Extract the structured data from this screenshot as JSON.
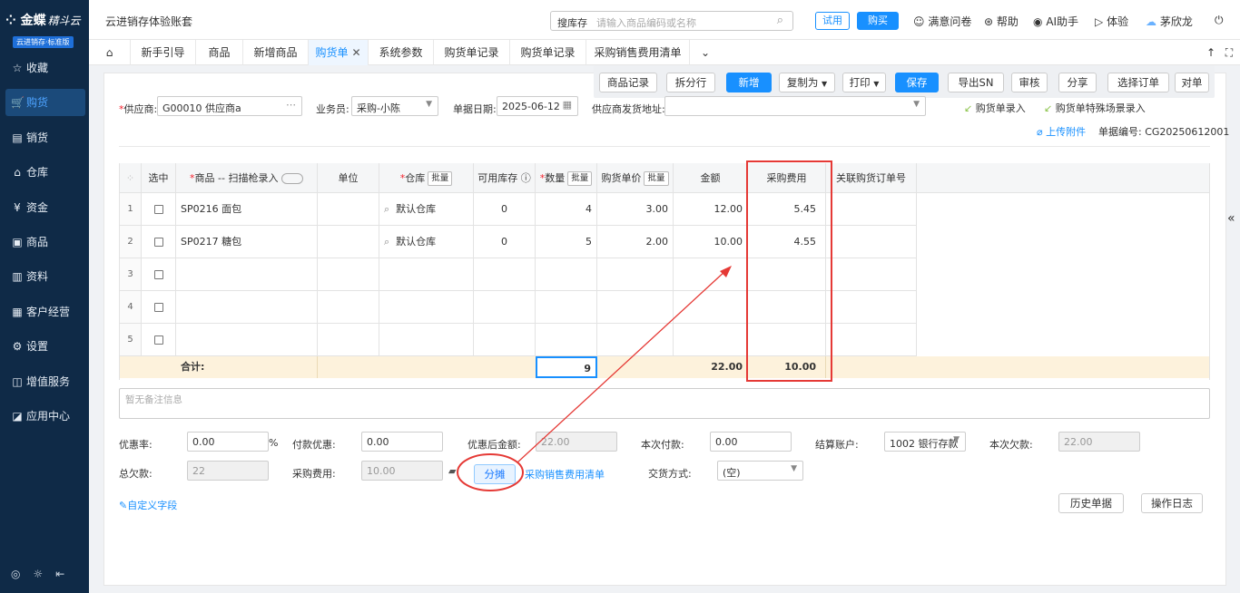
{
  "brand": {
    "name": "金蝶",
    "sub": "精斗云",
    "badge": "云进销存·标准版"
  },
  "nav": [
    {
      "label": "收藏",
      "icon": "star-icon",
      "glyph": "☆"
    },
    {
      "label": "购货",
      "icon": "cart-icon",
      "glyph": "🛒"
    },
    {
      "label": "销货",
      "icon": "sales-doc-icon",
      "glyph": "▤"
    },
    {
      "label": "仓库",
      "icon": "warehouse-icon",
      "glyph": "⌂"
    },
    {
      "label": "资金",
      "icon": "money-icon",
      "glyph": "¥"
    },
    {
      "label": "商品",
      "icon": "goods-icon",
      "glyph": "▣"
    },
    {
      "label": "资料",
      "icon": "data-icon",
      "glyph": "▥"
    },
    {
      "label": "客户经营",
      "icon": "chart-icon",
      "glyph": "▦"
    },
    {
      "label": "设置",
      "icon": "settings-icon",
      "glyph": "⚙"
    },
    {
      "label": "增值服务",
      "icon": "service-icon",
      "glyph": "◫"
    },
    {
      "label": "应用中心",
      "icon": "apps-icon",
      "glyph": "◪"
    }
  ],
  "sidebar_bottom": [
    "◎",
    "☼",
    "⇤"
  ],
  "topbar": {
    "account": "云进销存体验账套",
    "search_label": "搜库存",
    "search_placeholder": "请输入商品编码或名称",
    "try": "试用",
    "buy": "购买",
    "survey": "满意问卷",
    "help": "帮助",
    "ai": "AI助手",
    "experience": "体验",
    "user": "茅欣龙"
  },
  "tabs": [
    "新手引导",
    "商品",
    "新增商品",
    "购货单",
    "系统参数",
    "购货单记录",
    "购货单记录",
    "采购销售费用清单"
  ],
  "toolbar": [
    "商品记录",
    "拆分行",
    "新增",
    "复制为",
    "打印",
    "保存",
    "导出SN",
    "审核",
    "分享",
    "选择订单",
    "对单"
  ],
  "form": {
    "supplier_label": "供应商:",
    "supplier": "G00010 供应商a",
    "staff_label": "业务员:",
    "staff": "采购-小陈",
    "date_label": "单据日期:",
    "date": "2025-06-12",
    "address_label": "供应商发货地址:",
    "entry_a": "购货单录入",
    "entry_b": "购货单特殊场景录入",
    "upload": "上传附件",
    "docno_label": "单据编号:",
    "docno": "CG20250612001"
  },
  "grid": {
    "headers": [
      "选中",
      "商品 -- 扫描枪录入",
      "单位",
      "仓库",
      "可用库存",
      "数量",
      "购货单价",
      "金额",
      "采购费用",
      "关联购货订单号"
    ],
    "batch": "批量",
    "rows": [
      {
        "no": "1",
        "product": "SP0216 面包",
        "warehouse": "默认仓库",
        "stock": "0",
        "qty": "4",
        "price": "3.00",
        "amount": "12.00",
        "fee": "5.45"
      },
      {
        "no": "2",
        "product": "SP0217 糖包",
        "warehouse": "默认仓库",
        "stock": "0",
        "qty": "5",
        "price": "2.00",
        "amount": "10.00",
        "fee": "4.55"
      },
      {
        "no": "3"
      },
      {
        "no": "4"
      },
      {
        "no": "5"
      }
    ],
    "total_label": "合计:",
    "total_qty": "9",
    "total_amount": "22.00",
    "total_fee": "10.00"
  },
  "remark_placeholder": "暂无备注信息",
  "footer": {
    "discount_rate_label": "优惠率:",
    "discount_rate": "0.00",
    "pct": "%",
    "pay_discount_label": "付款优惠:",
    "pay_discount": "0.00",
    "after_discount_label": "优惠后金额:",
    "after_discount": "22.00",
    "this_pay_label": "本次付款:",
    "this_pay": "0.00",
    "account_label": "结算账户:",
    "account": "1002 银行存款",
    "this_owe_label": "本次欠款:",
    "this_owe": "22.00",
    "total_owe_label": "总欠款:",
    "total_owe": "22",
    "fee_label": "采购费用:",
    "fee": "10.00",
    "allocate": "分摊",
    "fee_list": "采购销售费用清单",
    "delivery_label": "交货方式:",
    "delivery": "(空)",
    "custom_fields": "自定义字段",
    "history": "历史单据",
    "log": "操作日志"
  },
  "colors": {
    "primary": "#1890ff",
    "sidebar": "#0f2a47",
    "highlight": "#e53935",
    "total_row": "#fdf2dc"
  }
}
